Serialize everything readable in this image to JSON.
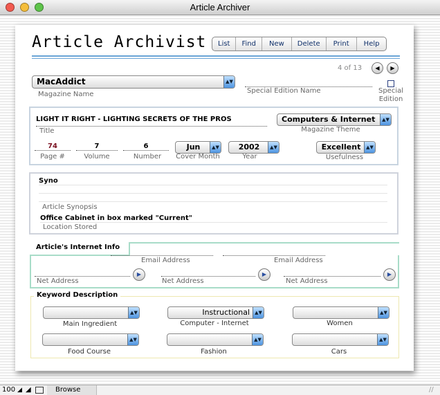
{
  "window": {
    "title": "Article Archiver"
  },
  "app": {
    "title": "Article Archivist"
  },
  "toolbar": [
    "List",
    "Find",
    "New",
    "Delete",
    "Print",
    "Help"
  ],
  "nav": {
    "record": "4 of 13",
    "prev_icon": "left-arrow-icon",
    "next_icon": "right-arrow-icon"
  },
  "magazine": {
    "name": "MacAddict",
    "name_label": "Magazine Name",
    "special_edition_label": "Special Edition Name",
    "special_edition_name": "",
    "special_checkbox_label": "Special Edition",
    "special_checked": false
  },
  "article": {
    "title": "LIGHT IT RIGHT - LIGHTING SECRETS OF THE PROS",
    "title_label": "Title",
    "theme": "Computers & Internet",
    "theme_label": "Magazine Theme",
    "page": "74",
    "page_label": "Page #",
    "volume": "7",
    "volume_label": "Volume",
    "number": "6",
    "number_label": "Number",
    "month": "Jun",
    "month_label": "Cover Month",
    "year": "2002",
    "year_label": "Year",
    "usefulness": "Excellent",
    "usefulness_label": "Usefulness"
  },
  "synopsis": {
    "text": "Syno",
    "label": "Article Synopsis",
    "location": "Office Cabinet in box marked \"Current\"",
    "location_label": "Location Stored"
  },
  "internet": {
    "heading": "Article's Internet Info",
    "email_label": "Email Address",
    "net_label": "Net Address"
  },
  "keywords": {
    "heading": "Keyword Description",
    "items": [
      {
        "label": "Main Ingredient",
        "value": ""
      },
      {
        "label": "Computer - Internet",
        "value": "Instructional"
      },
      {
        "label": "Women",
        "value": ""
      },
      {
        "label": "Food Course",
        "value": ""
      },
      {
        "label": "Fashion",
        "value": ""
      },
      {
        "label": "Cars",
        "value": ""
      }
    ]
  },
  "status": {
    "zoom": "100",
    "mode": "Browse"
  },
  "colors": {
    "accent": "#6aa4d6",
    "page_number": "#7a1020",
    "internet_border": "#a8dcc8",
    "keyword_border": "#eee8b0"
  }
}
